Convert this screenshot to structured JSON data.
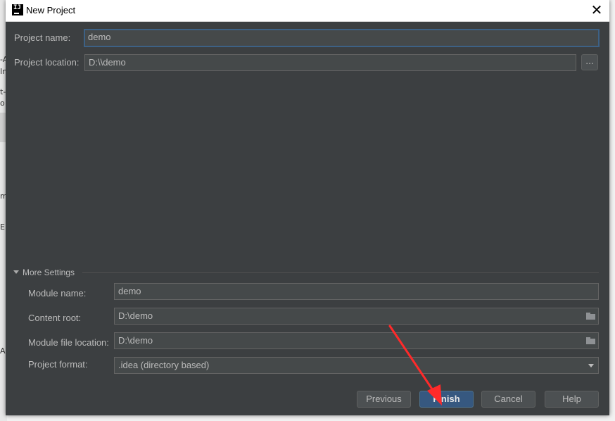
{
  "window": {
    "title": "New Project",
    "icon": "intellij-idea-icon",
    "close_glyph": "✕"
  },
  "form": {
    "project_name": {
      "label": "Project name:",
      "value": "demo"
    },
    "project_location": {
      "label": "Project location:",
      "value": "D:\\\\demo",
      "browse_label": "..."
    }
  },
  "more_settings": {
    "label": "More Settings",
    "expanded": true,
    "module_name": {
      "label": "Module name:",
      "value": "demo"
    },
    "content_root": {
      "label": "Content root:",
      "value": "D:\\demo",
      "icon": "folder-icon"
    },
    "module_file_location": {
      "label": "Module file location:",
      "value": "D:\\demo",
      "icon": "folder-icon"
    },
    "project_format": {
      "label": "Project format:",
      "value": ".idea (directory based)"
    }
  },
  "buttons": {
    "previous": "Previous",
    "finish": "Finish",
    "cancel": "Cancel",
    "help": "Help"
  },
  "annotation": {
    "type": "red-arrow",
    "color": "#ff2a2a",
    "points_to": "finish-button"
  },
  "background_fragments": [
    "-A",
    "In",
    "t-",
    "o",
    "m",
    "E",
    "AL"
  ],
  "colors": {
    "dialog_bg": "#3c3f41",
    "field_bg": "#45494a",
    "text": "#bbbbbb",
    "focus_border": "#3d6185",
    "primary_button": "#365880"
  }
}
